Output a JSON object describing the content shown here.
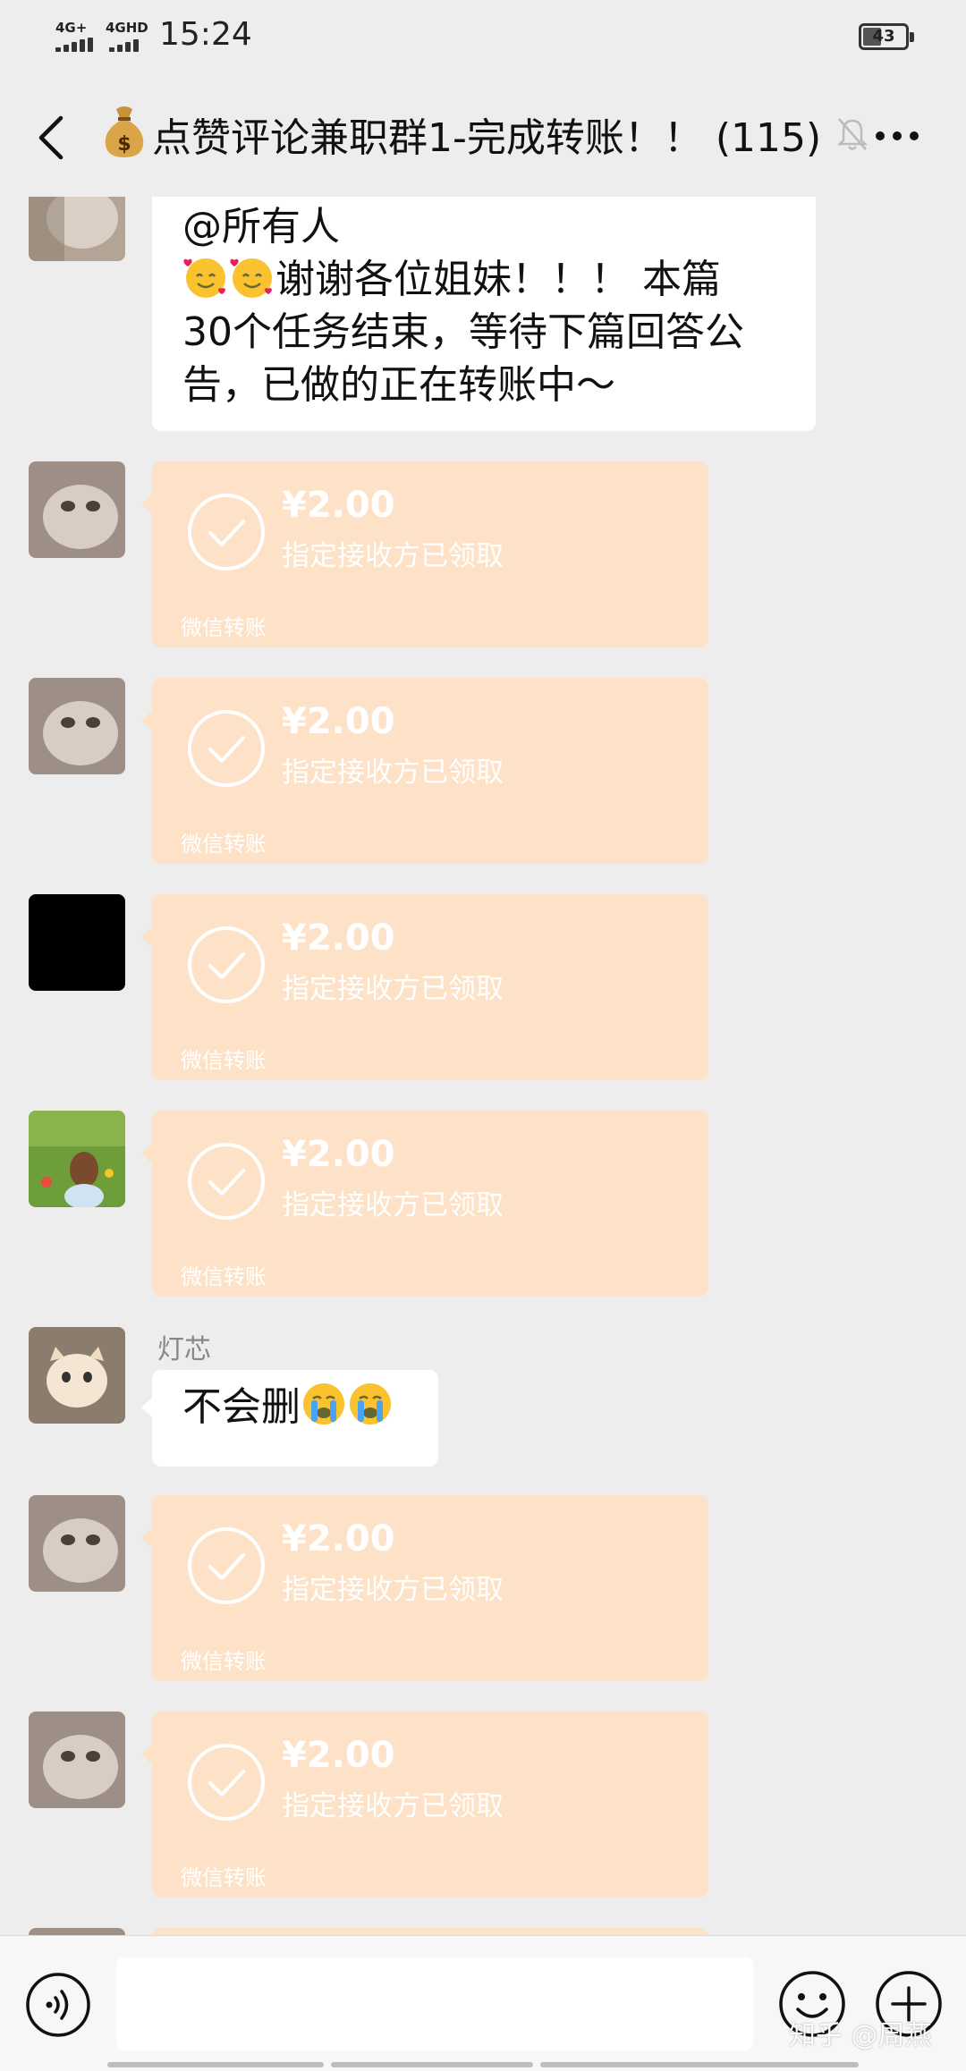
{
  "status_bar": {
    "signal1": "4G+",
    "signal2": "4GHD",
    "time": "15:24",
    "battery": "43"
  },
  "header": {
    "title": "点赞评论兼职群1-完成转账！！ (115)"
  },
  "messages": {
    "announcement": {
      "line1": "@所有人",
      "line2": "谢谢各位姐妹！！！ 本篇",
      "line3": "30个任务结束，等待下篇回答公",
      "line4": "告，已做的正在转账中～"
    },
    "transfers": [
      {
        "amount": "¥2.00",
        "status": "指定接收方已领取",
        "footer": "微信转账"
      },
      {
        "amount": "¥2.00",
        "status": "指定接收方已领取",
        "footer": "微信转账"
      },
      {
        "amount": "¥2.00",
        "status": "指定接收方已领取",
        "footer": "微信转账"
      },
      {
        "amount": "¥2.00",
        "status": "指定接收方已领取",
        "footer": "微信转账"
      },
      {
        "amount": "¥2.00",
        "status": "指定接收方已领取",
        "footer": "微信转账"
      },
      {
        "amount": "¥2.00",
        "status": "指定接收方已领取",
        "footer": "微信转账"
      }
    ],
    "reply": {
      "sender": "灯芯",
      "text": "不会删"
    }
  },
  "bottom_bar": {
    "watermark": "知乎 @周燕"
  },
  "colors": {
    "background": "#ededed",
    "transfer_bubble": "#fde2c7",
    "text_bubble": "#ffffff"
  }
}
